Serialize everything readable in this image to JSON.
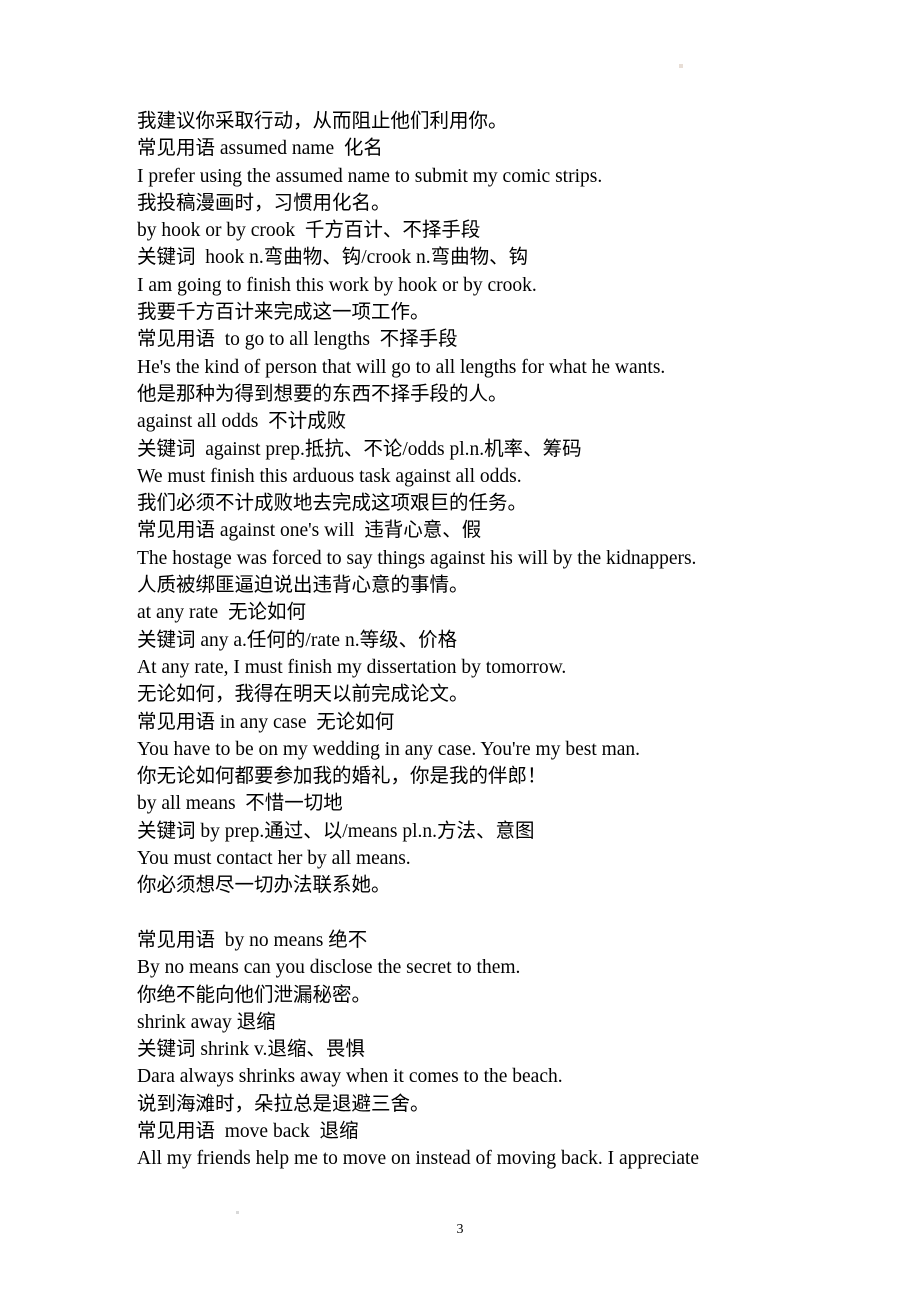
{
  "document": {
    "page_number": "3",
    "lines": [
      {
        "id": "l1",
        "text": "我建议你采取行动，从而阻止他们利用你。"
      },
      {
        "id": "l2",
        "text": "常见用语 assumed name  化名"
      },
      {
        "id": "l3",
        "text": "I prefer using the assumed name to submit my comic strips."
      },
      {
        "id": "l4",
        "text": "我投稿漫画时，习惯用化名。"
      },
      {
        "id": "l5",
        "text": "by hook or by crook  千方百计、不择手段"
      },
      {
        "id": "l6",
        "text": "关键词  hook n.弯曲物、钩/crook n.弯曲物、钩"
      },
      {
        "id": "l7",
        "text": "I am going to finish this work by hook or by crook."
      },
      {
        "id": "l8",
        "text": "我要千方百计来完成这一项工作。"
      },
      {
        "id": "l9",
        "text": "常见用语  to go to all lengths  不择手段"
      },
      {
        "id": "l10",
        "text": "He's the kind of person that will go to all lengths for what he wants."
      },
      {
        "id": "l11",
        "text": "他是那种为得到想要的东西不择手段的人。"
      },
      {
        "id": "l12",
        "text": "against all odds  不计成败"
      },
      {
        "id": "l13",
        "text": "关键词  against prep.抵抗、不论/odds pl.n.机率、筹码"
      },
      {
        "id": "l14",
        "text": "We must finish this arduous task against all odds."
      },
      {
        "id": "l15",
        "text": "我们必须不计成败地去完成这项艰巨的任务。"
      },
      {
        "id": "l16",
        "text": "常见用语 against one's will  违背心意、假"
      },
      {
        "id": "l17",
        "text": "The hostage was forced to say things against his will by the kidnappers."
      },
      {
        "id": "l18",
        "text": "人质被绑匪逼迫说出违背心意的事情。"
      },
      {
        "id": "l19",
        "text": "at any rate  无论如何"
      },
      {
        "id": "l20",
        "text": "关键词 any a.任何的/rate n.等级、价格"
      },
      {
        "id": "l21",
        "text": "At any rate, I must finish my dissertation by tomorrow."
      },
      {
        "id": "l22",
        "text": "无论如何，我得在明天以前完成论文。"
      },
      {
        "id": "l23",
        "text": "常见用语 in any case  无论如何"
      },
      {
        "id": "l24",
        "text": "You have to be on my wedding in any case. You're my best man."
      },
      {
        "id": "l25",
        "text": "你无论如何都要参加我的婚礼，你是我的伴郎！"
      },
      {
        "id": "l26",
        "text": "by all means  不惜一切地"
      },
      {
        "id": "l27",
        "text": "关键词 by prep.通过、以/means pl.n.方法、意图"
      },
      {
        "id": "l28",
        "text": "You must contact her by all means."
      },
      {
        "id": "l29",
        "text": "你必须想尽一切办法联系她。"
      },
      {
        "id": "l30",
        "text": ""
      },
      {
        "id": "l31",
        "text": "常见用语  by no means 绝不"
      },
      {
        "id": "l32",
        "text": "By no means can you disclose the secret to them."
      },
      {
        "id": "l33",
        "text": "你绝不能向他们泄漏秘密。"
      },
      {
        "id": "l34",
        "text": "shrink away 退缩"
      },
      {
        "id": "l35",
        "text": "关键词 shrink v.退缩、畏惧"
      },
      {
        "id": "l36",
        "text": "Dara always shrinks away when it comes to the beach."
      },
      {
        "id": "l37",
        "text": "说到海滩时，朵拉总是退避三舍。"
      },
      {
        "id": "l38",
        "text": "常见用语  move back  退缩"
      },
      {
        "id": "l39",
        "text": "All my friends help me to move on instead of moving back. I appreciate"
      }
    ]
  }
}
